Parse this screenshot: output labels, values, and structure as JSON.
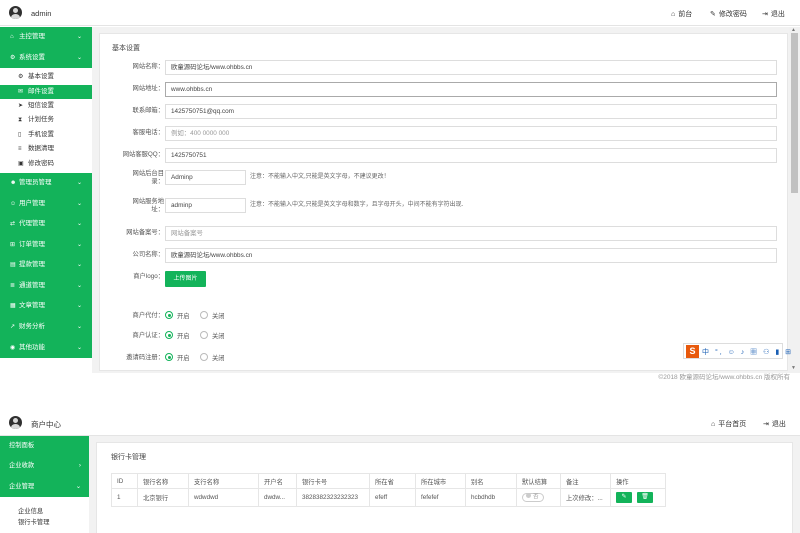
{
  "screen1": {
    "top": {
      "user": "admin",
      "links": [
        {
          "icon": "home-icon",
          "glyph": "⌂",
          "label": "前台"
        },
        {
          "icon": "edit-icon",
          "glyph": "✎",
          "label": "修改密码"
        },
        {
          "icon": "logout-icon",
          "glyph": "⇥",
          "label": "退出"
        }
      ]
    },
    "sidebar": {
      "before": [
        {
          "icon": "home-icon",
          "glyph": "⌂",
          "label": "主控管理"
        },
        {
          "icon": "cogs-icon",
          "glyph": "⚙",
          "label": "系统设置",
          "open": true
        }
      ],
      "subitems": [
        {
          "icon": "gear-icon",
          "glyph": "⚙",
          "label": "基本设置"
        },
        {
          "icon": "mail-icon",
          "glyph": "✉",
          "label": "邮件设置",
          "active": true
        },
        {
          "icon": "send-icon",
          "glyph": "➤",
          "label": "短信设置"
        },
        {
          "icon": "hourglass-icon",
          "glyph": "⧗",
          "label": "计划任务"
        },
        {
          "icon": "mobile-icon",
          "glyph": "▯",
          "label": "手机设置"
        },
        {
          "icon": "database-icon",
          "glyph": "≡",
          "label": "数据清理"
        },
        {
          "icon": "lock-icon",
          "glyph": "▣",
          "label": "修改密码"
        }
      ],
      "after": [
        {
          "icon": "admin-icon",
          "glyph": "☻",
          "label": "管理员管理"
        },
        {
          "icon": "users-icon",
          "glyph": "☺",
          "label": "用户管理"
        },
        {
          "icon": "agent-icon",
          "glyph": "⇄",
          "label": "代理管理"
        },
        {
          "icon": "cart-icon",
          "glyph": "⊞",
          "label": "订单管理"
        },
        {
          "icon": "withdraw-icon",
          "glyph": "▤",
          "label": "提款管理"
        },
        {
          "icon": "channel-icon",
          "glyph": "≣",
          "label": "通道管理"
        },
        {
          "icon": "article-icon",
          "glyph": "▦",
          "label": "文章管理"
        },
        {
          "icon": "chart-icon",
          "glyph": "↗",
          "label": "财务分析"
        },
        {
          "icon": "more-icon",
          "glyph": "◉",
          "label": "其他功能"
        }
      ]
    },
    "form": {
      "title": "基本设置",
      "fields": [
        {
          "label": "网站名称：",
          "value": "欧童源码论坛/www.ohbbs.cn",
          "placeholder": false
        },
        {
          "label": "网站地址：",
          "value": "www.ohbbs.cn",
          "placeholder": false
        },
        {
          "label": "联系邮箱：",
          "value": "1425750751@qq.com",
          "placeholder": false
        },
        {
          "label": "客服电话：",
          "value": "例如：400 0000 000",
          "placeholder": true
        },
        {
          "label": "网站客服QQ：",
          "value": "1425750751",
          "placeholder": false
        }
      ],
      "admin_dir": {
        "label1": "网站后台目",
        "label2": "录：",
        "value": "Adminp",
        "hint": "注意：不能输入中文,只能是英文字母，不建议更改！"
      },
      "merchant_dir": {
        "label1": "网站服务地",
        "label2": "址：",
        "value": "adminp",
        "hint": "注意：不能输入中文,只能是英文字母和数字，且字母开头，中间不能有字符出现."
      },
      "icp": {
        "label": "网站备案号：",
        "value": "网站备案号"
      },
      "company": {
        "label": "公司名称：",
        "value": "欧童源码论坛/www.ohbbs.cn"
      },
      "logo": {
        "label": "商户logo：",
        "button": "上传图片"
      },
      "radios": [
        {
          "label": "商户代付：",
          "on": "开启",
          "off": "关闭"
        },
        {
          "label": "商户认证：",
          "on": "开启",
          "off": "关闭"
        },
        {
          "label": "邀请码注册：",
          "on": "开启",
          "off": "关闭"
        }
      ]
    },
    "copyright": "©2018 欧童源码论坛/www.ohbbs.cn 版权所有",
    "ime": {
      "logo": "S",
      "items": "中 °, ☺ ♪ ▦ ⚇ ▮ ⊞"
    }
  },
  "screen2": {
    "top": {
      "user": "商户中心",
      "links": [
        {
          "icon": "home-icon",
          "glyph": "⌂",
          "label": "平台首页"
        },
        {
          "icon": "logout-icon",
          "glyph": "⇥",
          "label": "退出"
        }
      ]
    },
    "sidebar": {
      "items": [
        {
          "label": "控制面板",
          "chev": ""
        },
        {
          "label": "企业收款",
          "chev": "›"
        },
        {
          "label": "企业管理",
          "chev": "⌄"
        }
      ],
      "subitems": [
        "企业信息",
        "银行卡管理"
      ]
    },
    "panel": {
      "title": "银行卡管理",
      "columns": [
        "ID",
        "银行名称",
        "支行名称",
        "开户名",
        "银行卡号",
        "所在省",
        "所在城市",
        "别名",
        "默认结算",
        "备注",
        "操作"
      ],
      "rows": [
        {
          "id": "1",
          "bank": "北京银行",
          "branch": "wdwdwd",
          "holder": "dwdw...",
          "card": "3828382323232323",
          "province": "efeff",
          "city": "fefefef",
          "alias": "hcbdhdb",
          "default": "否",
          "note": "上次修改：...",
          "edit": "✎",
          "del": "🗑"
        }
      ]
    }
  }
}
